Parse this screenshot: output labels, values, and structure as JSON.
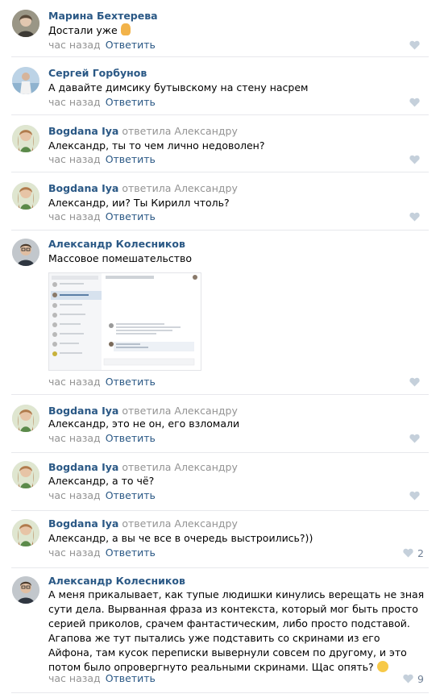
{
  "comments": [
    {
      "author": "Марина Бехтерева",
      "reply": "",
      "target": "",
      "text": "Достали уже",
      "time": "час назад",
      "reply_label": "Ответить",
      "likes": ""
    },
    {
      "author": "Сергей Горбунов",
      "reply": "",
      "target": "",
      "text": "А давайте димсику бутывскому на стену насрем",
      "time": "час назад",
      "reply_label": "Ответить",
      "likes": ""
    },
    {
      "author": "Bogdana Iya",
      "reply": "ответила",
      "target": "Александру",
      "text": "Александр, ты то чем лично недоволен?",
      "time": "час назад",
      "reply_label": "Ответить",
      "likes": ""
    },
    {
      "author": "Bogdana Iya",
      "reply": "ответила",
      "target": "Александру",
      "text": "Александр, ии? Ты Кирилл чтоль?",
      "time": "час назад",
      "reply_label": "Ответить",
      "likes": ""
    },
    {
      "author": "Александр Колесников",
      "reply": "",
      "target": "",
      "text": "Массовое помешательство",
      "time": "час назад",
      "reply_label": "Ответить",
      "likes": ""
    },
    {
      "author": "Bogdana Iya",
      "reply": "ответила",
      "target": "Александру",
      "text": "Александр, это не он, его взломали",
      "time": "час назад",
      "reply_label": "Ответить",
      "likes": ""
    },
    {
      "author": "Bogdana Iya",
      "reply": "ответила",
      "target": "Александру",
      "text": "Александр, а то чё?",
      "time": "час назад",
      "reply_label": "Ответить",
      "likes": ""
    },
    {
      "author": "Bogdana Iya",
      "reply": "ответила",
      "target": "Александру",
      "text": "Александр, а вы че все в очередь выстроились?))",
      "time": "час назад",
      "reply_label": "Ответить",
      "likes": "2"
    },
    {
      "author": "Александр Колесников",
      "reply": "",
      "target": "",
      "text": "А меня прикалывает, как тупые людишки кинулись верещать не зная сути дела. Вырванная фраза из контекста, который мог быть просто серией приколов, срачем фантастическим, либо просто подставой. Агапова же тут пытались уже подставить со скринами из его Айфона, там кусок переписки вывернули совсем по другому, и это потом было опровергнуто реальными скринами. Щас опять?",
      "time": "час назад",
      "reply_label": "Ответить",
      "likes": "9"
    }
  ],
  "icons": {
    "like": "heart-icon",
    "emoji_person": "person-emoji-icon",
    "emoji_smile": "smile-emoji-icon"
  },
  "colors": {
    "link": "#2a5885",
    "muted": "#939393",
    "like": "#6e7f95",
    "separator": "#e7e8ec"
  }
}
